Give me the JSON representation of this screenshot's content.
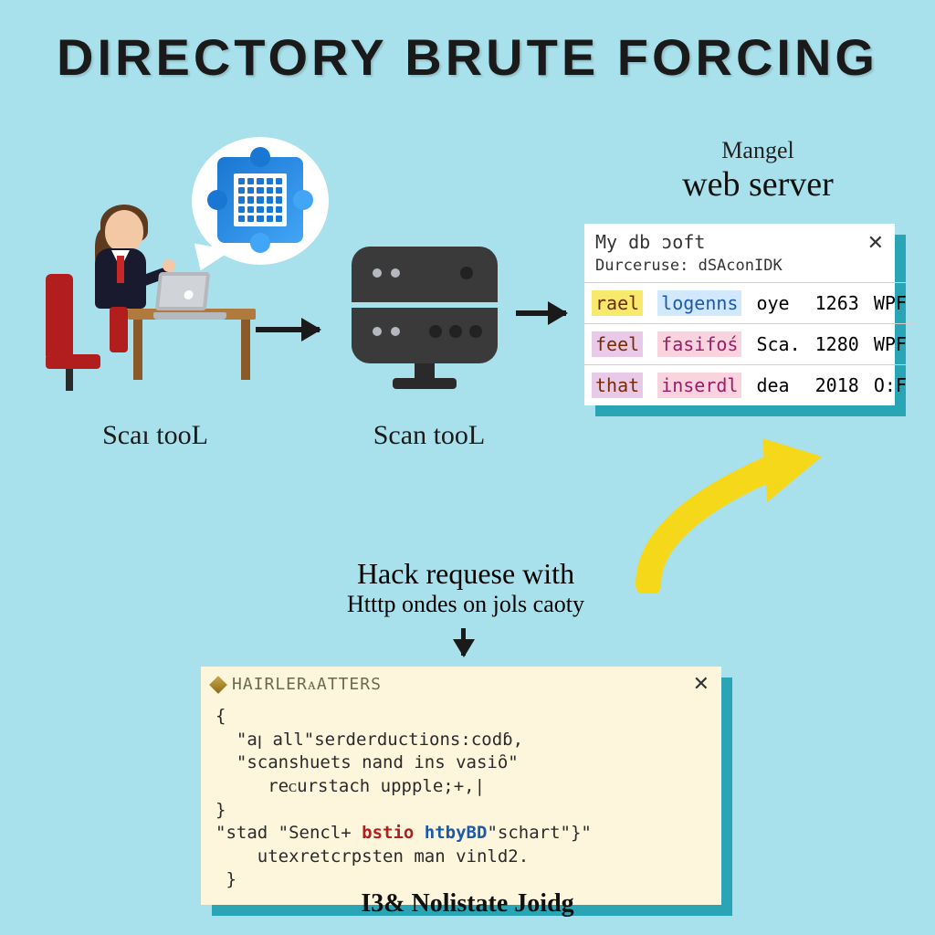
{
  "title": "DIRECTORY BRUTE FORCING",
  "labels": {
    "person": "Scaı tooL",
    "server": "Scan tooL",
    "webserver_small": "Mangel",
    "webserver_big": "web server"
  },
  "db_window": {
    "title": "My db ɔoft",
    "subtitle": "Durceruse:  dSAconIDK",
    "rows": [
      {
        "c1": "rael",
        "c2": "logenns",
        "c3": "oye",
        "c4": "1263",
        "c5": "WPF"
      },
      {
        "c1": "feel",
        "c2": "fasifoś",
        "c3": "Sca.",
        "c4": "1280",
        "c5": "WPF"
      },
      {
        "c1": "that",
        "c2": "inserdl",
        "c3": "dea",
        "c4": "2018",
        "c5": "O:F"
      }
    ]
  },
  "mid": {
    "line1a": "Hack requese",
    "line1b": " with",
    "line2": "Htttp ondes on jols caoty"
  },
  "code": {
    "header": "HAIRLERᴀATTERS",
    "l1": "{",
    "l2": "  \"aꞁ all\"serderductions:codɓ,",
    "l3": "  \"scanshuets nand ins vasiȏ\"",
    "l4": "     reᴄurstach uppple;+,|",
    "l5": "}",
    "l6_a": "\"stad \"Sencl+ ",
    "l6_b": "bstio",
    "l6_c": " htbyBD",
    "l6_d": "\"schart\"}\"",
    "l7": "    utexretcrpsten man vinld2.",
    "l8": " }"
  },
  "footer": "I3& Nolistate Joidg"
}
